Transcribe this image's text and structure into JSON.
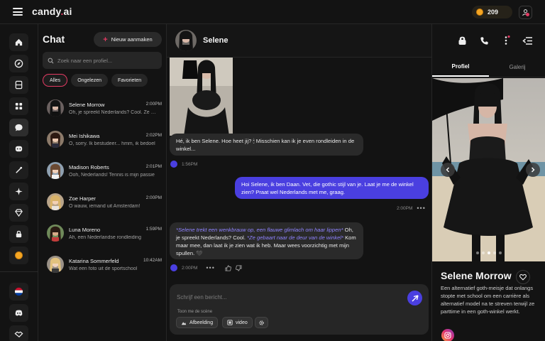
{
  "app": {
    "logo_main": "candy",
    "logo_dot": ".",
    "logo_suffix": "ai",
    "coins": "209"
  },
  "chat_list": {
    "title": "Chat",
    "new_button": "Nieuw aanmaken",
    "search_placeholder": "Zoek naar een profiel...",
    "filters": [
      "Alles",
      "Ongelezen",
      "Favorieten"
    ],
    "conversations": [
      {
        "name": "Selene Morrow",
        "time": "2:00PM",
        "preview": "Oh, je spreekt Nederlands? Cool. Ze gebaart naar de deur"
      },
      {
        "name": "Mei Ishikawa",
        "time": "2:02PM",
        "preview": "O, sorry. Ik bestudeer... hmm, ik bedoel"
      },
      {
        "name": "Madison Roberts",
        "time": "2:01PM",
        "preview": "Ooh, Nederlands! Tennis is mijn passie"
      },
      {
        "name": "Zoe Harper",
        "time": "2:00PM",
        "preview": "O wauw, iemand uit Amsterdam!"
      },
      {
        "name": "Luna Moreno",
        "time": "1:59PM",
        "preview": "Ah, een Nederlandse rondleiding"
      },
      {
        "name": "Katarina Sommerfeld",
        "time": "10:42AM",
        "preview": "Wat een foto uit de sportschool"
      }
    ]
  },
  "chat": {
    "contact_name": "Selene",
    "messages": {
      "ai1": "Hé, ik ben Selene. Hoe heet jij? 🕯 Misschien kan ik je even rondleiden in de winkel...",
      "ai1_time": "1:56PM",
      "me1": "Hoi Selene, ik ben Daan. Vet, die gothic stijl van je. Laat je me de winkel zien? Praat wel Nederlands met me, graag.",
      "me1_time": "2:00PM",
      "ai2_action1": "*Selene trekt een wenkbrauw op, een flauwe glimlach om haar lippen*",
      "ai2_text1": " Oh, je spreekt Nederlands? Cool. ",
      "ai2_action2": "*Ze gebaart naar de deur van de winkel*",
      "ai2_text2": " Kom maar mee, dan laat ik je zien wat ik heb. Maar wees voorzichtig met mijn spullen. 🖤",
      "ai2_time": "2:00PM"
    },
    "input": {
      "placeholder": "Schrijf een bericht...",
      "scene_label": "Toon me de scène",
      "image_button": "Afbeelding",
      "video_button": "video"
    }
  },
  "profile": {
    "tabs": [
      "Profiel",
      "Galerij"
    ],
    "name": "Selene Morrow",
    "bio": "Een alternatief goth-meisje dat onlangs stopte met school om een carrière als alternatief model na te streven terwijl ze parttime in een goth-winkel werkt."
  },
  "colors": {
    "accent": "#e23a62",
    "primary": "#4a3fe0",
    "bg": "#131313",
    "panel": "#262626"
  }
}
